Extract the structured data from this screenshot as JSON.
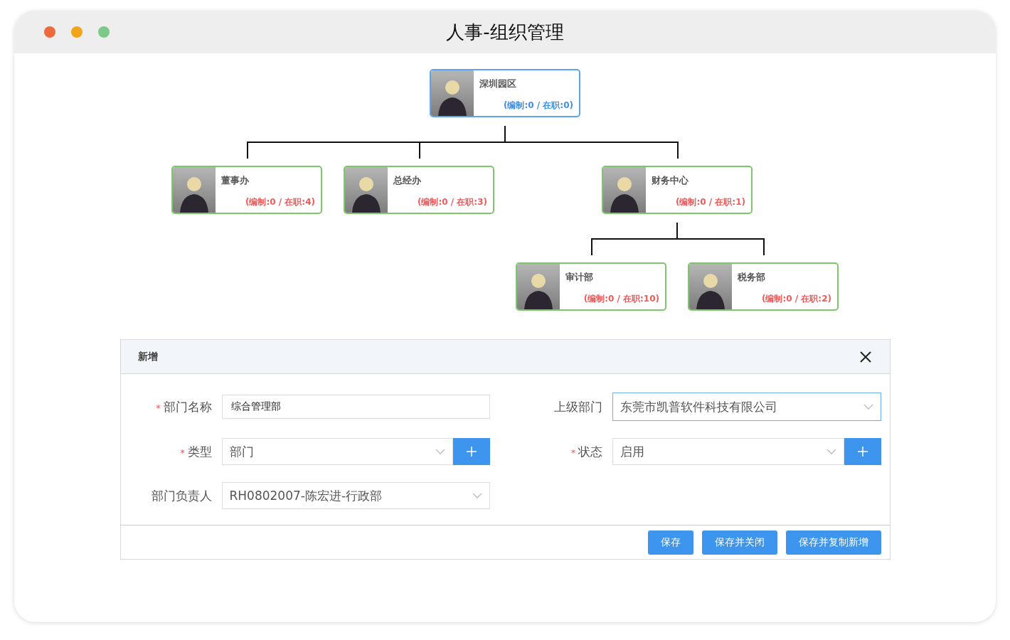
{
  "window": {
    "title": "人事-组织管理"
  },
  "org_chart": {
    "root": {
      "name": "深圳园区",
      "counts": "(编制:0 / 在职:0)",
      "selected": true,
      "children": [
        {
          "name": "董事办",
          "counts": "(编制:0 / 在职:4)",
          "selected": false
        },
        {
          "name": "总经办",
          "counts": "(编制:0 / 在职:3)",
          "selected": false
        },
        {
          "name": "财务中心",
          "counts": "(编制:0 / 在职:1)",
          "selected": false,
          "children": [
            {
              "name": "审计部",
              "counts": "(编制:0 / 在职:10)",
              "selected": false
            },
            {
              "name": "税务部",
              "counts": "(编制:0 / 在职:2)",
              "selected": false
            }
          ]
        }
      ]
    }
  },
  "dialog": {
    "title": "新增",
    "fields": [
      {
        "label": "部门名称",
        "required_mark": "*",
        "kind": "text",
        "value": "综合管理部",
        "focused": false
      },
      {
        "label": "上级部门",
        "kind": "select",
        "value": "东莞市凯普软件科技有限公司",
        "focused": true
      },
      {
        "label": "类型",
        "required_mark": "*",
        "kind": "select_add",
        "value": "部门",
        "focused": false
      },
      {
        "label": "状态",
        "required_mark": "*",
        "kind": "select_add",
        "value": "启用",
        "focused": false
      },
      {
        "label": "部门负责人",
        "kind": "select",
        "value": "RH0802007-陈宏进-行政部",
        "focused": false
      }
    ],
    "buttons": [
      "保存",
      "保存并关闭",
      "保存并复制新增"
    ]
  }
}
